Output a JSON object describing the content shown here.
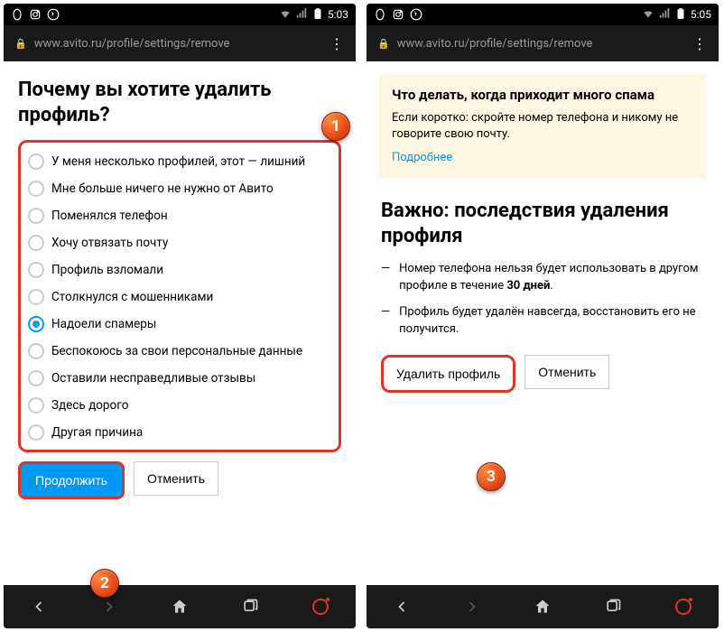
{
  "left": {
    "time": "5:03",
    "url": "www.avito.ru/profile/settings/remove",
    "title": "Почему вы хотите удалить профиль?",
    "options": [
      "У меня несколько профилей, этот — лишний",
      "Мне больше ничего не нужно от Авито",
      "Поменялся телефон",
      "Хочу отвязать почту",
      "Профиль взломали",
      "Столкнулся с мошенниками",
      "Надоели спамеры",
      "Беспокоюсь за свои персональные данные",
      "Оставили несправедливые отзывы",
      "Здесь дорого",
      "Другая причина"
    ],
    "selected_index": 6,
    "continue": "Продолжить",
    "cancel": "Отменить"
  },
  "right": {
    "time": "5:05",
    "url": "www.avito.ru/profile/settings/remove",
    "info_title": "Что делать, когда приходит много спама",
    "info_text": "Если коротко: скройте номер телефона и никому не говорите свою почту.",
    "info_link": "Подробнее",
    "title": "Важно: последствия удаления профиля",
    "items": [
      {
        "pre": "Номер телефона нельзя будет использовать в другом профиле в течение ",
        "bold": "30 дней",
        "post": "."
      },
      {
        "pre": "Профиль будет удалён навсегда, восстановить его не получится.",
        "bold": "",
        "post": ""
      }
    ],
    "delete": "Удалить профиль",
    "cancel": "Отменить"
  },
  "badges": {
    "b1": "1",
    "b2": "2",
    "b3": "3"
  },
  "icons": {
    "opera": "O",
    "instagram": "◻",
    "shazam": "S"
  }
}
